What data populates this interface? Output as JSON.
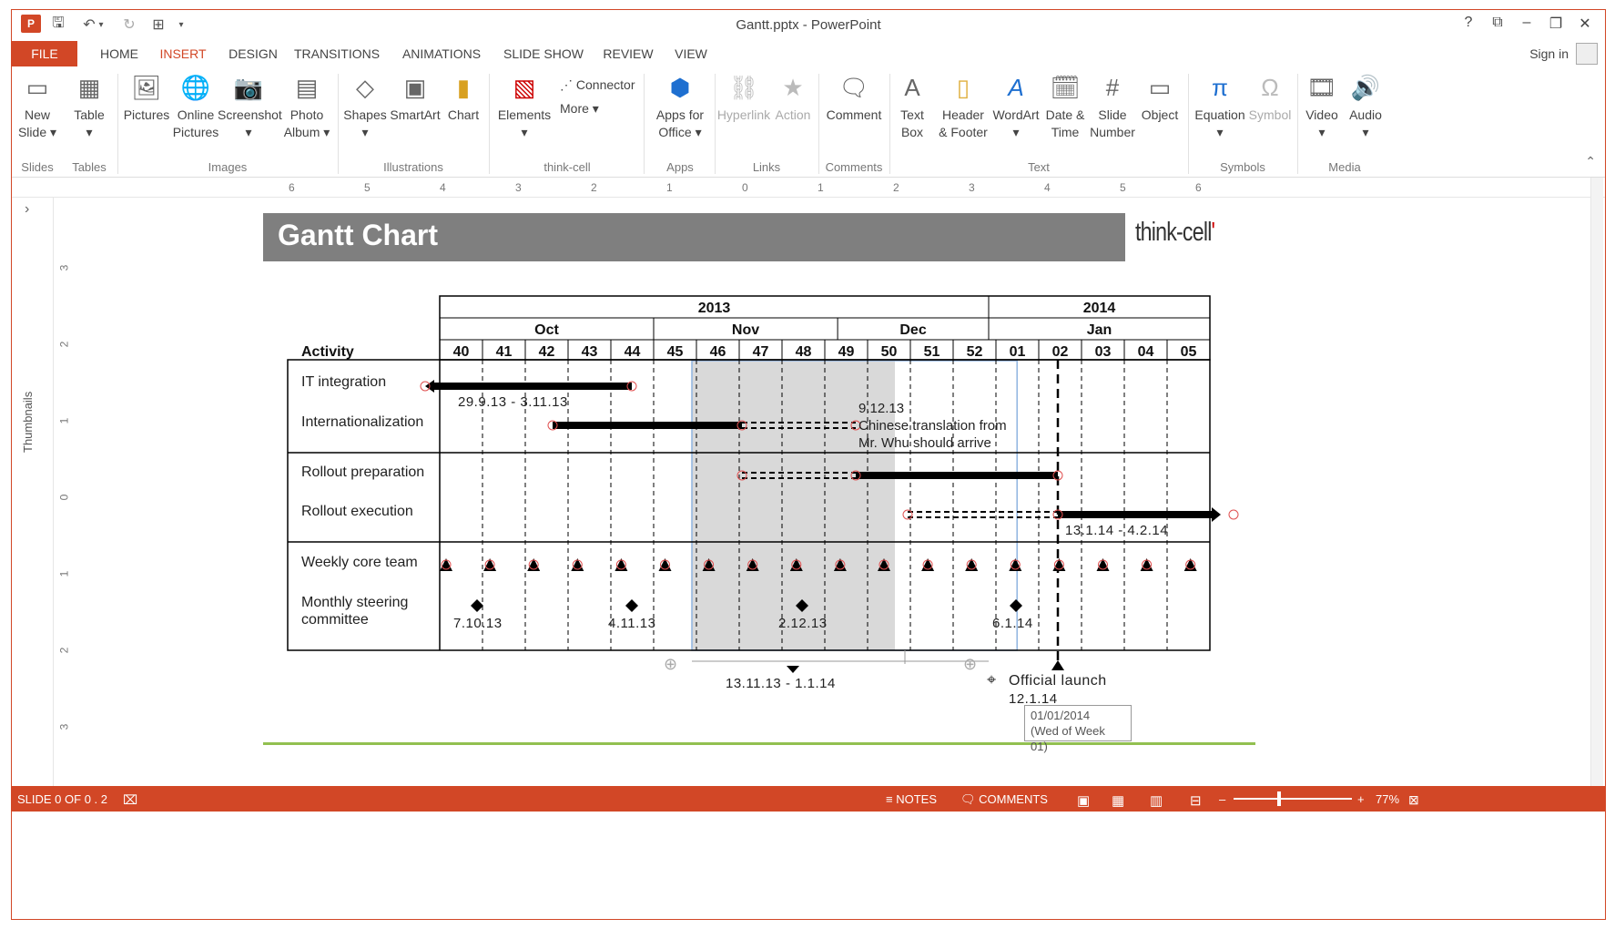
{
  "window": {
    "title": "Gantt.pptx - PowerPoint",
    "help": "?",
    "ribbon_display": "⧉",
    "minimize": "–",
    "restore": "❐",
    "close": "✕"
  },
  "quick_access": {
    "save": "🖫",
    "undo": "↶",
    "undo_drop": "▾",
    "redo": "↻",
    "present": "⊞",
    "customize": "▾"
  },
  "tabs": [
    {
      "label": "FILE"
    },
    {
      "label": "HOME"
    },
    {
      "label": "INSERT"
    },
    {
      "label": "DESIGN"
    },
    {
      "label": "TRANSITIONS"
    },
    {
      "label": "ANIMATIONS"
    },
    {
      "label": "SLIDE SHOW"
    },
    {
      "label": "REVIEW"
    },
    {
      "label": "VIEW"
    }
  ],
  "account": {
    "signin": "Sign in"
  },
  "ribbon": {
    "buttons": [
      {
        "label": "New\nSlide ▾",
        "icon": "new-slide-icon"
      },
      {
        "label": "Table\n▾",
        "icon": "table-icon"
      },
      {
        "label": "Pictures",
        "icon": "pictures-icon"
      },
      {
        "label": "Online\nPictures",
        "icon": "online-pictures-icon"
      },
      {
        "label": "Screenshot\n▾",
        "icon": "screenshot-icon"
      },
      {
        "label": "Photo\nAlbum ▾",
        "icon": "photo-album-icon"
      },
      {
        "label": "Shapes\n▾",
        "icon": "shapes-icon"
      },
      {
        "label": "SmartArt",
        "icon": "smartart-icon"
      },
      {
        "label": "Chart",
        "icon": "chart-icon"
      },
      {
        "label": "Elements\n▾",
        "icon": "elements-icon"
      },
      {
        "label": "Apps for\nOffice ▾",
        "icon": "apps-icon"
      },
      {
        "label": "Hyperlink",
        "icon": "hyperlink-icon"
      },
      {
        "label": "Action",
        "icon": "action-icon"
      },
      {
        "label": "Comment",
        "icon": "comment-icon"
      },
      {
        "label": "Text\nBox",
        "icon": "text-box-icon"
      },
      {
        "label": "Header\n& Footer",
        "icon": "header-footer-icon"
      },
      {
        "label": "WordArt\n▾",
        "icon": "wordart-icon"
      },
      {
        "label": "Date &\nTime",
        "icon": "date-time-icon"
      },
      {
        "label": "Slide\nNumber",
        "icon": "slide-number-icon"
      },
      {
        "label": "Object",
        "icon": "object-icon"
      },
      {
        "label": "Equation\n▾",
        "icon": "equation-icon"
      },
      {
        "label": "Symbol",
        "icon": "symbol-icon"
      },
      {
        "label": "Video\n▾",
        "icon": "video-icon"
      },
      {
        "label": "Audio\n▾",
        "icon": "audio-icon"
      }
    ],
    "connector": "Connector",
    "more": "More ▾",
    "groups": [
      "Slides",
      "Tables",
      "Images",
      "Illustrations",
      "think-cell",
      "Apps",
      "Links",
      "Comments",
      "Text",
      "Symbols",
      "Media"
    ],
    "collapse": "⌃"
  },
  "ruler": [
    "6",
    "5",
    "4",
    "3",
    "2",
    "1",
    "0",
    "1",
    "2",
    "3",
    "4",
    "5",
    "6"
  ],
  "vruler": [
    "3",
    "2",
    "1",
    "0",
    "1",
    "2",
    "3"
  ],
  "thumbnails": {
    "label": "Thumbnails",
    "arrow": "›"
  },
  "slide": {
    "title": "Gantt Chart",
    "logo": "think-cell",
    "logo_mark": "'"
  },
  "gantt": {
    "years": [
      "2013",
      "2014"
    ],
    "months": [
      "Oct",
      "Nov",
      "Dec",
      "Jan"
    ],
    "weeks": [
      "40",
      "41",
      "42",
      "43",
      "44",
      "45",
      "46",
      "47",
      "48",
      "49",
      "50",
      "51",
      "52",
      "01",
      "02",
      "03",
      "04",
      "05"
    ],
    "activity_header": "Activity",
    "activities": [
      "IT integration",
      "Internationalization",
      "Rollout preparation",
      "Rollout execution",
      "Weekly core team",
      "Monthly steering\ncommittee"
    ],
    "labels": {
      "it_range": "29.9.13 - 3.11.13",
      "intl_date": "9.12.13",
      "intl_note1": "Chinese translation from",
      "intl_note2": "Mr. Whu should arrive",
      "rollout_exec_range": "13.1.14 - 4.2.14",
      "m1": "7.10.13",
      "m2": "4.11.13",
      "m3": "2.12.13",
      "m4": "6.1.14",
      "shade_range": "13.11.13 - 1.1.14",
      "launch": "Official launch",
      "launch_date": "12.1.14"
    },
    "tooltip": {
      "line1": "01/01/2014",
      "line2": "(Wed of Week 01)"
    }
  },
  "statusbar": {
    "slide": "SLIDE 0 OF 0 . 2",
    "notes": "NOTES",
    "comments": "COMMENTS",
    "zoom_minus": "–",
    "zoom_plus": "+",
    "zoom": "77%"
  },
  "colors": {
    "accent": "#d24726",
    "title_bar": "#7f7f7f",
    "shade": "#d9d9d9",
    "green_line": "#92c050"
  }
}
